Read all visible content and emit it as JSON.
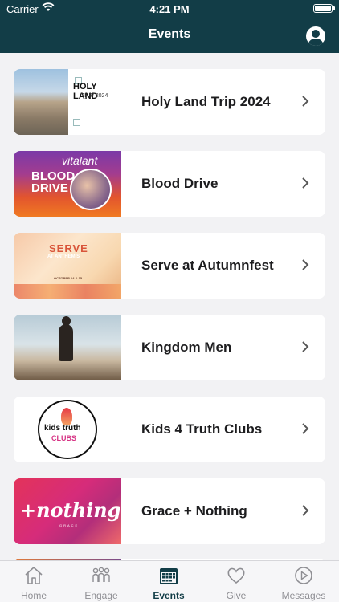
{
  "status": {
    "carrier": "Carrier",
    "time": "4:21 PM"
  },
  "header": {
    "title": "Events"
  },
  "events": [
    {
      "label": "Holy Land Trip 2024",
      "thumb": {
        "title": "HOLY LAND",
        "subtitle": "TRIP 2024"
      }
    },
    {
      "label": "Blood Drive",
      "thumb": {
        "brand": "vitalant",
        "title": "BLOOD DRIVE"
      }
    },
    {
      "label": "Serve at Autumnfest",
      "thumb": {
        "title": "SERVE",
        "subtitle": "AT ANTHEM'S",
        "date": "OCTOBER 14 & 15"
      }
    },
    {
      "label": "Kingdom Men"
    },
    {
      "label": "Kids 4 Truth Clubs",
      "thumb": {
        "line1": "kids truth",
        "line2": "CLUBS"
      }
    },
    {
      "label": "Grace + Nothing",
      "thumb": {
        "title": "+nothing",
        "subtitle": "GRACE"
      }
    }
  ],
  "tabs": [
    {
      "label": "Home",
      "icon": "home-icon"
    },
    {
      "label": "Engage",
      "icon": "people-icon"
    },
    {
      "label": "Events",
      "icon": "calendar-icon",
      "active": true
    },
    {
      "label": "Give",
      "icon": "heart-icon"
    },
    {
      "label": "Messages",
      "icon": "play-icon"
    }
  ],
  "colors": {
    "header": "#123d47",
    "active_tab": "#123d47",
    "inactive_tab": "#8e8e93",
    "background": "#f2f2f4"
  }
}
